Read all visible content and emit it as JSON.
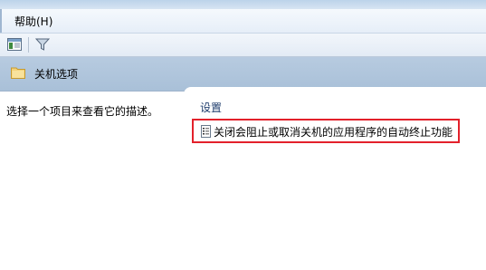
{
  "menu": {
    "help_label": "帮助(H)"
  },
  "toolbar": {
    "buttons": [
      {
        "icon": "show-hide-pane-icon"
      },
      {
        "icon": "filter-icon"
      }
    ]
  },
  "header": {
    "title": "关机选项",
    "icon": "folder-icon"
  },
  "description_pane": {
    "text": "选择一个项目来查看它的描述。"
  },
  "settings_pane": {
    "column_header": "设置",
    "items": [
      {
        "label": "关闭会阻止或取消关机的应用程序的自动终止功能",
        "icon": "policy-setting-icon"
      }
    ]
  },
  "colors": {
    "highlight_border": "#e3212b",
    "header_bg": "#b7cbe0"
  }
}
